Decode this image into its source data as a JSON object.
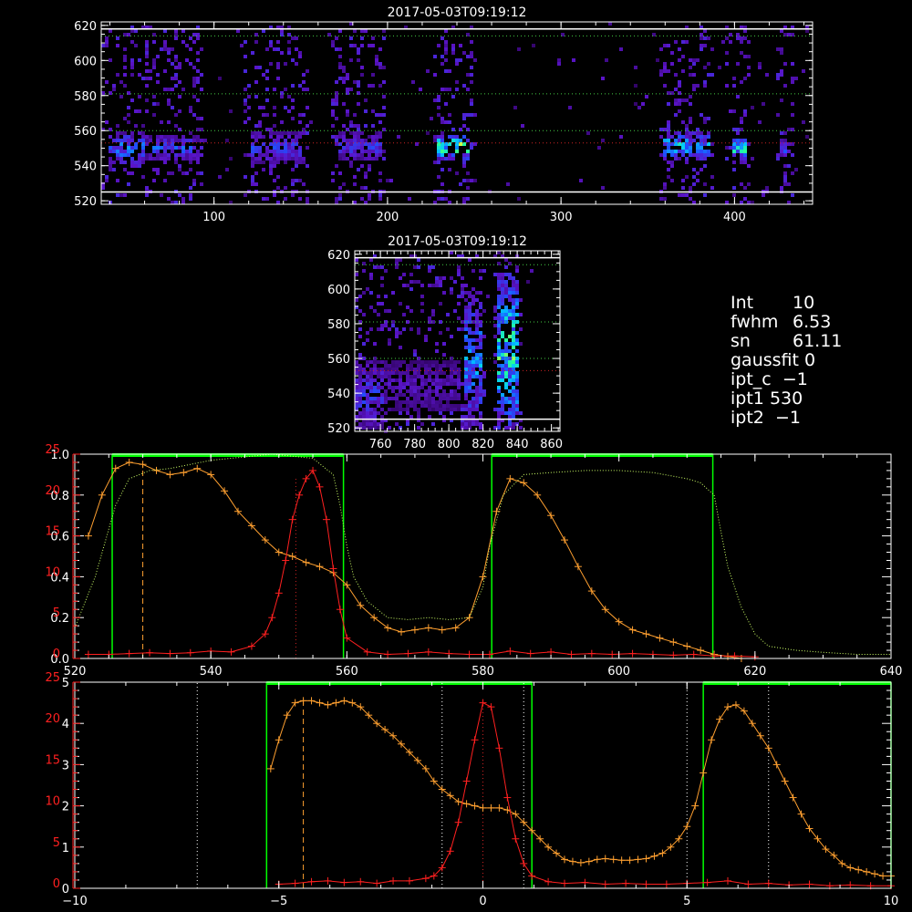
{
  "info_panel": [
    {
      "key": "Int",
      "value": "10"
    },
    {
      "key": "fwhm",
      "value": "6.53"
    },
    {
      "key": "sn",
      "value": "61.11"
    },
    {
      "key": "gaussfit",
      "value": "0"
    },
    {
      "key": "ipt_c",
      "value": "−1"
    },
    {
      "key": "ipt1",
      "value": "530"
    },
    {
      "key": "ipt2",
      "value": "−1"
    }
  ],
  "colors": {
    "bg": "#000000",
    "axis": "#ffffff",
    "orange": "#ffa030",
    "red": "#ff2020",
    "green": "#00ff00",
    "yellow_dots": "#ccff66",
    "green_dots": "#44cc44",
    "red_dots": "#cc2222"
  },
  "chart_data": [
    {
      "type": "heatmap",
      "title": "2017-05-03T09:19:12",
      "xlim": [
        35,
        445
      ],
      "ylim": [
        518,
        622
      ],
      "xticks": [
        100,
        200,
        300,
        400
      ],
      "yticks": [
        520,
        540,
        560,
        580,
        600,
        620
      ],
      "colormap": "rainbow",
      "horizontal_lines": [
        {
          "y": 618,
          "color": "#ffffff",
          "style": "solid"
        },
        {
          "y": 525,
          "color": "#ffffff",
          "style": "solid"
        },
        {
          "y": 614,
          "color": "#44cc44",
          "style": "dotted"
        },
        {
          "y": 581,
          "color": "#44cc44",
          "style": "dotted"
        },
        {
          "y": 560,
          "color": "#44cc44",
          "style": "dotted"
        },
        {
          "y": 553,
          "color": "#cc2222",
          "style": "dotted"
        }
      ],
      "bright_regions": [
        {
          "x": [
            38,
            60
          ],
          "y": [
            542,
            560
          ],
          "intensity": 0.55
        },
        {
          "x": [
            62,
            90
          ],
          "y": [
            544,
            558
          ],
          "intensity": 0.45
        },
        {
          "x": [
            120,
            150
          ],
          "y": [
            542,
            560
          ],
          "intensity": 0.4
        },
        {
          "x": [
            170,
            195
          ],
          "y": [
            544,
            560
          ],
          "intensity": 0.4
        },
        {
          "x": [
            228,
            246
          ],
          "y": [
            545,
            559
          ],
          "intensity": 0.85
        },
        {
          "x": [
            358,
            385
          ],
          "y": [
            544,
            560
          ],
          "intensity": 0.65
        },
        {
          "x": [
            397,
            406
          ],
          "y": [
            546,
            556
          ],
          "intensity": 0.85
        },
        {
          "x": [
            425,
            430
          ],
          "y": [
            546,
            556
          ],
          "intensity": 0.5
        }
      ]
    },
    {
      "type": "heatmap",
      "title": "2017-05-03T09:19:12",
      "xlim": [
        745,
        865
      ],
      "ylim": [
        518,
        622
      ],
      "xticks": [
        760,
        780,
        800,
        820,
        840,
        860
      ],
      "yticks": [
        520,
        540,
        560,
        580,
        600,
        620
      ],
      "colormap": "rainbow",
      "horizontal_lines": [
        {
          "y": 618,
          "color": "#ffffff",
          "style": "solid"
        },
        {
          "y": 525,
          "color": "#ffffff",
          "style": "solid"
        },
        {
          "y": 614,
          "color": "#44cc44",
          "style": "dotted"
        },
        {
          "y": 581,
          "color": "#44cc44",
          "style": "dotted"
        },
        {
          "y": 560,
          "color": "#44cc44",
          "style": "dotted"
        },
        {
          "y": 553,
          "color": "#cc2222",
          "style": "dotted"
        }
      ],
      "bright_regions": [
        {
          "x": [
            745,
            760
          ],
          "y": [
            520,
            560
          ],
          "intensity": 0.4
        },
        {
          "x": [
            808,
            818
          ],
          "y": [
            520,
            600
          ],
          "intensity": 0.55
        },
        {
          "x": [
            828,
            840
          ],
          "y": [
            520,
            610
          ],
          "intensity": 0.75
        },
        {
          "x": [
            760,
            805
          ],
          "y": [
            530,
            560
          ],
          "intensity": 0.25
        }
      ]
    },
    {
      "type": "line",
      "xlim": [
        520,
        640
      ],
      "xticks": [
        520,
        540,
        560,
        580,
        600,
        620,
        640
      ],
      "left_axis_white": {
        "ylim": [
          0,
          1.0
        ],
        "ticks": [
          "0.0",
          "0.2",
          "0.4",
          "0.6",
          "0.8",
          "1.0"
        ]
      },
      "left_axis_red": {
        "ylim": [
          0,
          25
        ],
        "ticks": [
          "0",
          "5",
          "10",
          "15",
          "20",
          "25"
        ]
      },
      "series": [
        {
          "color": "orange",
          "scale": "white",
          "marker": "+",
          "x": [
            522,
            524,
            526,
            528,
            530,
            532,
            534,
            536,
            538,
            540,
            542,
            544,
            546,
            548,
            550,
            552,
            554,
            556,
            558,
            560,
            562,
            564,
            566,
            568,
            570,
            572,
            574,
            576,
            578,
            580,
            582,
            584,
            586,
            588,
            590,
            592,
            594,
            596,
            598,
            600,
            602,
            604,
            606,
            608,
            610,
            612,
            614,
            616,
            618
          ],
          "y": [
            0.6,
            0.8,
            0.93,
            0.96,
            0.95,
            0.92,
            0.9,
            0.91,
            0.93,
            0.9,
            0.82,
            0.72,
            0.65,
            0.58,
            0.52,
            0.5,
            0.47,
            0.45,
            0.42,
            0.36,
            0.26,
            0.2,
            0.15,
            0.13,
            0.14,
            0.15,
            0.14,
            0.15,
            0.2,
            0.4,
            0.72,
            0.88,
            0.86,
            0.8,
            0.7,
            0.58,
            0.45,
            0.33,
            0.24,
            0.18,
            0.14,
            0.12,
            0.1,
            0.08,
            0.06,
            0.04,
            0.02,
            0.01,
            0.0
          ]
        },
        {
          "color": "red",
          "scale": "red",
          "marker": "+",
          "x": [
            522,
            525,
            528,
            531,
            534,
            537,
            540,
            543,
            546,
            548,
            549,
            550,
            551,
            552,
            553,
            554,
            555,
            556,
            557,
            558,
            559,
            560,
            563,
            566,
            569,
            572,
            575,
            578,
            581,
            584,
            587,
            590,
            593,
            596,
            599,
            602,
            605,
            608,
            611,
            614,
            617,
            620
          ],
          "y": [
            0.5,
            0.5,
            0.6,
            0.7,
            0.6,
            0.7,
            0.9,
            0.8,
            1.5,
            3.0,
            5.0,
            8.0,
            12.0,
            17.0,
            20.0,
            22.0,
            23.0,
            21.0,
            17.0,
            11.0,
            6.0,
            2.5,
            0.8,
            0.5,
            0.6,
            0.8,
            0.6,
            0.5,
            0.5,
            0.9,
            0.6,
            0.8,
            0.5,
            0.6,
            0.5,
            0.6,
            0.5,
            0.4,
            0.5,
            0.3,
            0.3,
            0.2
          ]
        },
        {
          "color": "yellow_dots",
          "scale": "white",
          "style": "dotted",
          "x": [
            520,
            523,
            526,
            528,
            531,
            534,
            537,
            540,
            543,
            546,
            549,
            552,
            555,
            558,
            559,
            560,
            561,
            563,
            566,
            569,
            572,
            575,
            578,
            580,
            581,
            583,
            586,
            590,
            595,
            600,
            605,
            610,
            612,
            614,
            615,
            616,
            618,
            620,
            622,
            626,
            630,
            635,
            640
          ],
          "y": [
            0.15,
            0.4,
            0.75,
            0.88,
            0.92,
            0.93,
            0.95,
            0.97,
            0.98,
            0.99,
            1.0,
            0.99,
            0.98,
            0.9,
            0.75,
            0.55,
            0.4,
            0.28,
            0.2,
            0.19,
            0.2,
            0.19,
            0.2,
            0.35,
            0.55,
            0.8,
            0.9,
            0.91,
            0.92,
            0.92,
            0.91,
            0.88,
            0.86,
            0.8,
            0.62,
            0.45,
            0.25,
            0.12,
            0.06,
            0.04,
            0.03,
            0.02,
            0.02
          ]
        }
      ],
      "green_boxes": [
        [
          525.5,
          559.5
        ],
        [
          581.3,
          613.8
        ]
      ],
      "vertical_lines": [
        {
          "x": 530,
          "color": "orange",
          "style": "dashed",
          "scale": "white",
          "top": 0.95
        },
        {
          "x": 552.5,
          "color": "red_dots",
          "style": "dotted",
          "scale": "red",
          "top": 22
        }
      ]
    },
    {
      "type": "line",
      "xlim": [
        -10,
        10
      ],
      "xticks": [
        -10,
        -5,
        0,
        5,
        10
      ],
      "left_axis_white": {
        "ylim": [
          0,
          5
        ],
        "ticks": [
          "0",
          "1",
          "2",
          "3",
          "4",
          "5"
        ]
      },
      "left_axis_red": {
        "ylim": [
          0,
          25
        ],
        "ticks": [
          "0",
          "5",
          "10",
          "15",
          "20",
          "25"
        ]
      },
      "series": [
        {
          "color": "orange",
          "scale": "white",
          "marker": "+",
          "x": [
            -5.2,
            -5.0,
            -4.8,
            -4.6,
            -4.4,
            -4.2,
            -4.0,
            -3.8,
            -3.6,
            -3.4,
            -3.2,
            -3.0,
            -2.8,
            -2.6,
            -2.4,
            -2.2,
            -2.0,
            -1.8,
            -1.6,
            -1.4,
            -1.2,
            -1.0,
            -0.8,
            -0.6,
            -0.4,
            -0.2,
            0.0,
            0.2,
            0.4,
            0.6,
            0.8,
            1.0,
            1.2,
            1.4,
            1.6,
            1.8,
            2.0,
            2.2,
            2.4,
            2.6,
            2.8,
            3.0,
            3.2,
            3.4,
            3.6,
            3.8,
            4.0,
            4.2,
            4.4,
            4.6,
            4.8,
            5.0,
            5.2,
            5.4,
            5.6,
            5.8,
            6.0,
            6.2,
            6.4,
            6.6,
            6.8,
            7.0,
            7.2,
            7.4,
            7.6,
            7.8,
            8.0,
            8.2,
            8.4,
            8.6,
            8.8,
            9.0,
            9.2,
            9.4,
            9.6,
            9.8,
            10.0
          ],
          "y": [
            2.9,
            3.6,
            4.2,
            4.5,
            4.55,
            4.55,
            4.5,
            4.45,
            4.5,
            4.55,
            4.5,
            4.4,
            4.2,
            4.0,
            3.85,
            3.7,
            3.5,
            3.3,
            3.1,
            2.9,
            2.6,
            2.4,
            2.25,
            2.1,
            2.05,
            2.0,
            1.95,
            1.95,
            1.95,
            1.9,
            1.8,
            1.6,
            1.4,
            1.2,
            1.0,
            0.85,
            0.7,
            0.65,
            0.62,
            0.65,
            0.7,
            0.72,
            0.7,
            0.68,
            0.68,
            0.7,
            0.72,
            0.78,
            0.85,
            1.0,
            1.2,
            1.5,
            2.0,
            2.8,
            3.6,
            4.1,
            4.4,
            4.45,
            4.3,
            4.0,
            3.7,
            3.4,
            3.0,
            2.6,
            2.2,
            1.8,
            1.45,
            1.2,
            0.95,
            0.8,
            0.6,
            0.5,
            0.45,
            0.4,
            0.35,
            0.3,
            0.3
          ]
        },
        {
          "color": "red",
          "scale": "red",
          "marker": "+",
          "x": [
            -5.0,
            -4.6,
            -4.2,
            -3.8,
            -3.4,
            -3.0,
            -2.6,
            -2.2,
            -1.8,
            -1.4,
            -1.2,
            -1.0,
            -0.8,
            -0.6,
            -0.4,
            -0.2,
            0.0,
            0.2,
            0.4,
            0.6,
            0.8,
            1.0,
            1.2,
            1.6,
            2.0,
            2.5,
            3.0,
            3.5,
            4.0,
            4.5,
            5.0,
            5.5,
            6.0,
            6.5,
            7.0,
            7.5,
            8.0,
            8.5,
            9.0,
            9.5,
            10.0
          ],
          "y": [
            0.5,
            0.6,
            0.8,
            0.9,
            0.7,
            0.8,
            0.6,
            0.9,
            0.9,
            1.2,
            1.5,
            2.5,
            4.5,
            8.0,
            13.0,
            18.0,
            22.5,
            22.0,
            17.0,
            11.0,
            6.0,
            3.0,
            1.5,
            0.8,
            0.6,
            0.7,
            0.5,
            0.6,
            0.5,
            0.5,
            0.6,
            0.7,
            0.9,
            0.5,
            0.6,
            0.4,
            0.5,
            0.3,
            0.4,
            0.3,
            0.3
          ]
        }
      ],
      "green_boxes": [
        [
          -5.3,
          1.2
        ],
        [
          5.4,
          10.0
        ]
      ],
      "vertical_lines": [
        {
          "x": -7.0,
          "color": "white",
          "style": "dotted"
        },
        {
          "x": -4.4,
          "color": "orange",
          "style": "dashed",
          "scale": "white",
          "top": 4.55
        },
        {
          "x": -1.0,
          "color": "white",
          "style": "dotted"
        },
        {
          "x": 0.0,
          "color": "red_dots",
          "style": "dotted",
          "scale": "red",
          "top": 22.5
        },
        {
          "x": 1.0,
          "color": "white",
          "style": "dotted"
        },
        {
          "x": 5.0,
          "color": "white",
          "style": "dotted"
        },
        {
          "x": 7.0,
          "color": "white",
          "style": "dotted"
        }
      ]
    }
  ]
}
